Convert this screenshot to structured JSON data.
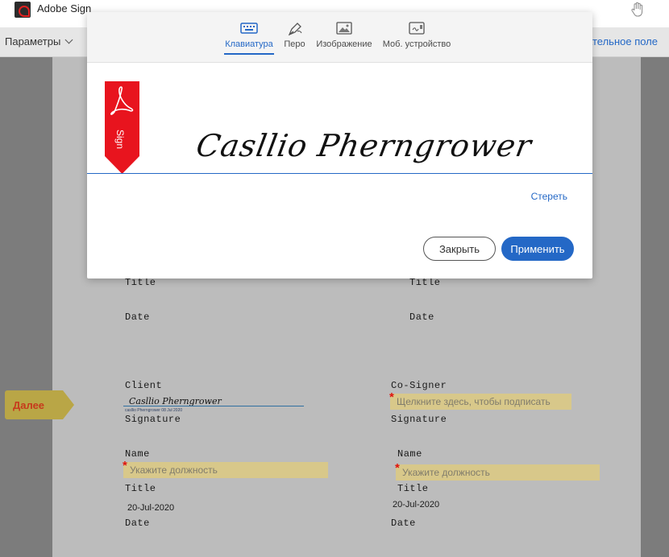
{
  "app": {
    "title": "Adobe Sign"
  },
  "toolbar": {
    "options_label": "Параметры",
    "required_field_label": "ательное поле"
  },
  "modal": {
    "tabs": [
      {
        "label": "Клавиатура",
        "icon": "keyboard-icon",
        "active": true
      },
      {
        "label": "Перо",
        "icon": "pen-icon",
        "active": false
      },
      {
        "label": "Изображение",
        "icon": "image-icon",
        "active": false
      },
      {
        "label": "Моб. устройство",
        "icon": "mobile-device-icon",
        "active": false
      }
    ],
    "flag_text": "Sign",
    "signature_text": "Casllio Pherngrower",
    "clear_label": "Стереть",
    "close_label": "Закрыть",
    "apply_label": "Применить"
  },
  "document": {
    "left": {
      "title_1": "Title",
      "date_1": "Date",
      "client_label": "Client",
      "signature_label": "Signature",
      "signed_value": "Casllio Pherngrower",
      "signed_caption": "casllio Pherngrower     08 Jul 2020",
      "name_label": "Name",
      "title_placeholder": "Укажите должность",
      "title_2": "Title",
      "date_value": "20-Jul-2020",
      "date_2": "Date"
    },
    "right": {
      "title_1": "Title",
      "date_1": "Date",
      "cosigner_label": "Co-Signer",
      "sign_placeholder": "Щелкните здесь, чтобы подписать",
      "signature_label": "Signature",
      "name_label": "Name",
      "title_placeholder": "Укажите должность",
      "title_2": "Title",
      "date_value": "20-Jul-2020",
      "date_2": "Date"
    },
    "next_label": "Далее"
  },
  "colors": {
    "accent": "#2468c6",
    "field_bg": "#d8c88a",
    "flag_red": "#e8141e",
    "next_tab": "#b9a646"
  }
}
